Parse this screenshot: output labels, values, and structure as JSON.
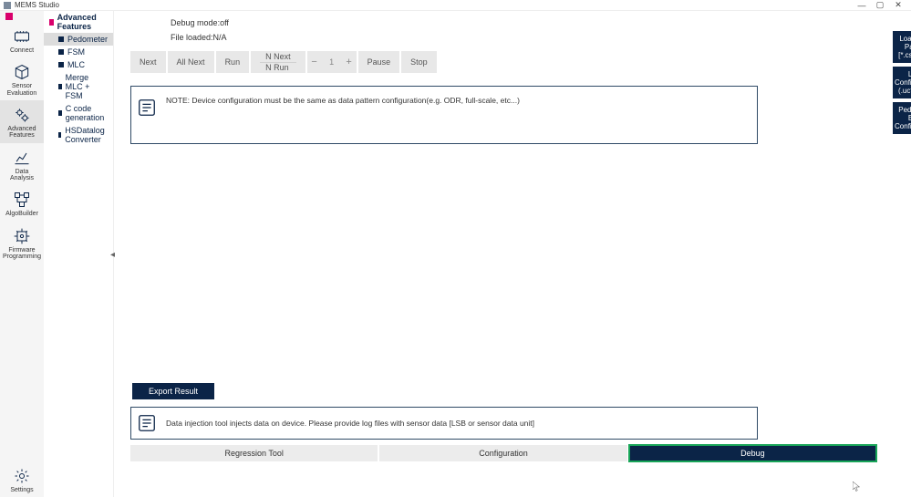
{
  "window": {
    "title": "MEMS Studio"
  },
  "rail": {
    "items": [
      {
        "id": "connect",
        "label": "Connect"
      },
      {
        "id": "sensor-evaluation",
        "label": "Sensor\nEvaluation"
      },
      {
        "id": "advanced-features",
        "label": "Advanced\nFeatures",
        "active": true
      },
      {
        "id": "data-analysis",
        "label": "Data\nAnalysis"
      },
      {
        "id": "algobuilder",
        "label": "AlgoBuilder"
      },
      {
        "id": "firmware-programming",
        "label": "Firmware\nProgramming"
      }
    ],
    "settings_label": "Settings"
  },
  "sidenav": {
    "heading": "Advanced Features",
    "items": [
      {
        "label": "Pedometer",
        "active": true
      },
      {
        "label": "FSM"
      },
      {
        "label": "MLC"
      },
      {
        "label": "Merge MLC + FSM"
      },
      {
        "label": "C code generation"
      },
      {
        "label": "HSDatalog Converter"
      }
    ]
  },
  "content": {
    "debug_mode": "Debug mode:off",
    "file_loaded": "File loaded:N/A",
    "toolbar": {
      "next": "Next",
      "all_next": "All Next",
      "run": "Run",
      "n_next": "N Next",
      "n_run": "N Run",
      "count": "1",
      "pause": "Pause",
      "stop": "Stop"
    },
    "note": "NOTE: Device configuration must be the same as data pattern configuration(e.g. ODR, full-scale, etc...)",
    "export_label": "Export Result",
    "info": "Data injection tool injects data on device. Please provide log files with sensor data [LSB or sensor data unit]",
    "tabs": {
      "regression": "Regression Tool",
      "configuration": "Configuration",
      "debug": "Debug"
    }
  },
  "right": {
    "load_pattern": "Load Data Pattern [*.csv, *.txt]",
    "load_config": "Load Configuration (.ucf, .json)",
    "pedo_config": "Pedometer Easy Configuration"
  }
}
